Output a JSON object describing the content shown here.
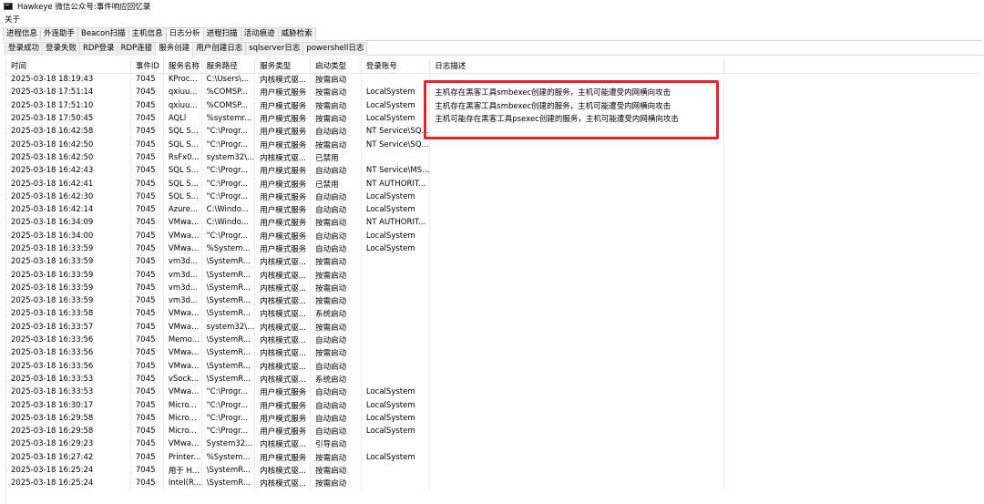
{
  "window": {
    "title": "Hawkeye 微信公众号:事件响应回忆录"
  },
  "menu": {
    "about": "关于"
  },
  "main_tabs": [
    {
      "label": "进程信息",
      "active": false
    },
    {
      "label": "外连助手",
      "active": false
    },
    {
      "label": "Beacon扫描",
      "active": false
    },
    {
      "label": "主机信息",
      "active": false
    },
    {
      "label": "日志分析",
      "active": true
    },
    {
      "label": "进程扫描",
      "active": false
    },
    {
      "label": "活动痕迹",
      "active": false
    },
    {
      "label": "威胁检索",
      "active": false
    }
  ],
  "sub_tabs": [
    {
      "label": "登录成功",
      "active": false
    },
    {
      "label": "登录失败",
      "active": false
    },
    {
      "label": "RDP登录",
      "active": false
    },
    {
      "label": "RDP连接",
      "active": false
    },
    {
      "label": "服务创建",
      "active": true
    },
    {
      "label": "用户创建日志",
      "active": false
    },
    {
      "label": "sqlserver日志",
      "active": false
    },
    {
      "label": "powershell日志",
      "active": false
    }
  ],
  "table": {
    "columns": [
      "时间",
      "事件ID",
      "服务名称",
      "服务路径",
      "服务类型",
      "启动类型",
      "登录账号",
      "日志描述"
    ],
    "rows": [
      [
        "2025-03-18 18:19:43",
        "7045",
        "KProc...",
        "C:\\Users\\...",
        "内核模式驱...",
        "按需启动",
        "",
        ""
      ],
      [
        "2025-03-18 17:51:14",
        "7045",
        "qxiuu...",
        "%COMSP...",
        "用户模式服务",
        "按需启动",
        "LocalSystem",
        "主机存在黑客工具smbexec创建的服务，主机可能遭受内网横向攻击"
      ],
      [
        "2025-03-18 17:51:10",
        "7045",
        "qxiuu...",
        "%COMSP...",
        "用户模式服务",
        "按需启动",
        "LocalSystem",
        "主机存在黑客工具smbexec创建的服务，主机可能遭受内网横向攻击"
      ],
      [
        "2025-03-18 17:50:45",
        "7045",
        "AQLl",
        "%systemr...",
        "用户模式服务",
        "按需启动",
        "LocalSystem",
        "主机可能存在黑客工具psexec创建的服务，主机可能遭受内网横向攻击"
      ],
      [
        "2025-03-18 16:42:58",
        "7045",
        "SQL S...",
        "\"C:\\Progr...",
        "用户模式服务",
        "自动启动",
        "NT Service\\SQ...",
        ""
      ],
      [
        "2025-03-18 16:42:50",
        "7045",
        "SQL S...",
        "\"C:\\Progr...",
        "用户模式服务",
        "按需启动",
        "NT Service\\SQ...",
        ""
      ],
      [
        "2025-03-18 16:42:50",
        "7045",
        "RsFx0...",
        "system32\\...",
        "内核模式驱...",
        "已禁用",
        "",
        ""
      ],
      [
        "2025-03-18 16:42:43",
        "7045",
        "SQL S...",
        "\"C:\\Progr...",
        "用户模式服务",
        "自动启动",
        "NT Service\\MS...",
        ""
      ],
      [
        "2025-03-18 16:42:41",
        "7045",
        "SQL S...",
        "\"C:\\Progr...",
        "用户模式服务",
        "已禁用",
        "NT AUTHORIT...",
        ""
      ],
      [
        "2025-03-18 16:42:30",
        "7045",
        "SQL S...",
        "\"C:\\Progr...",
        "用户模式服务",
        "自动启动",
        "LocalSystem",
        ""
      ],
      [
        "2025-03-18 16:42:14",
        "7045",
        "Azure...",
        "C:\\Windo...",
        "用户模式服务",
        "自动启动",
        "LocalSystem",
        ""
      ],
      [
        "2025-03-18 16:34:09",
        "7045",
        "VMwa...",
        "C:\\Windo...",
        "用户模式服务",
        "按需启动",
        "NT AUTHORIT...",
        ""
      ],
      [
        "2025-03-18 16:34:00",
        "7045",
        "VMwa...",
        "\"C:\\Progr...",
        "用户模式服务",
        "自动启动",
        "LocalSystem",
        ""
      ],
      [
        "2025-03-18 16:33:59",
        "7045",
        "VMwa...",
        "%System...",
        "用户模式服务",
        "自动启动",
        "LocalSystem",
        ""
      ],
      [
        "2025-03-18 16:33:59",
        "7045",
        "vm3d...",
        "\\SystemR...",
        "内核模式驱...",
        "按需启动",
        "",
        ""
      ],
      [
        "2025-03-18 16:33:59",
        "7045",
        "vm3d...",
        "\\SystemR...",
        "内核模式驱...",
        "按需启动",
        "",
        ""
      ],
      [
        "2025-03-18 16:33:59",
        "7045",
        "vm3d...",
        "\\SystemR...",
        "内核模式驱...",
        "按需启动",
        "",
        ""
      ],
      [
        "2025-03-18 16:33:59",
        "7045",
        "vm3d...",
        "\\SystemR...",
        "内核模式驱...",
        "按需启动",
        "",
        ""
      ],
      [
        "2025-03-18 16:33:58",
        "7045",
        "VMwa...",
        "\\SystemR...",
        "内核模式驱...",
        "系统启动",
        "",
        ""
      ],
      [
        "2025-03-18 16:33:57",
        "7045",
        "VMwa...",
        "system32\\...",
        "内核模式驱...",
        "按需启动",
        "",
        ""
      ],
      [
        "2025-03-18 16:33:56",
        "7045",
        "Memo...",
        "\\SystemR...",
        "内核模式驱...",
        "自动启动",
        "",
        ""
      ],
      [
        "2025-03-18 16:33:56",
        "7045",
        "VMwa...",
        "\\SystemR...",
        "内核模式驱...",
        "按需启动",
        "",
        ""
      ],
      [
        "2025-03-18 16:33:56",
        "7045",
        "VMwa...",
        "\\SystemR...",
        "内核模式驱...",
        "自动启动",
        "",
        ""
      ],
      [
        "2025-03-18 16:33:53",
        "7045",
        "vSock...",
        "\\SystemR...",
        "内核模式驱...",
        "系统启动",
        "",
        ""
      ],
      [
        "2025-03-18 16:33:53",
        "7045",
        "VMwa...",
        "\"C:\\Progr...",
        "用户模式服务",
        "自动启动",
        "LocalSystem",
        ""
      ],
      [
        "2025-03-18 16:30:17",
        "7045",
        "Micro...",
        "\"C:\\Progr...",
        "用户模式服务",
        "自动启动",
        "LocalSystem",
        ""
      ],
      [
        "2025-03-18 16:29:58",
        "7045",
        "Micro...",
        "\"C:\\Progr...",
        "用户模式服务",
        "自动启动",
        "LocalSystem",
        ""
      ],
      [
        "2025-03-18 16:29:58",
        "7045",
        "Micro...",
        "\"C:\\Progr...",
        "用户模式服务",
        "自动启动",
        "LocalSystem",
        ""
      ],
      [
        "2025-03-18 16:29:23",
        "7045",
        "VMwa...",
        "System32...",
        "内核模式驱...",
        "引导启动",
        "",
        ""
      ],
      [
        "2025-03-18 16:27:42",
        "7045",
        "Printer...",
        "%System...",
        "用户模式服务",
        "按需启动",
        "LocalSystem",
        ""
      ],
      [
        "2025-03-18 16:25:24",
        "7045",
        "用于 H...",
        "\\SystemR...",
        "内核模式驱...",
        "按需启动",
        "",
        ""
      ],
      [
        "2025-03-18 16:25:24",
        "7045",
        "Intel(R...",
        "\\SystemR...",
        "内核模式驱...",
        "按需启动",
        "",
        ""
      ]
    ]
  },
  "highlight": {
    "color": "#e8212b"
  }
}
